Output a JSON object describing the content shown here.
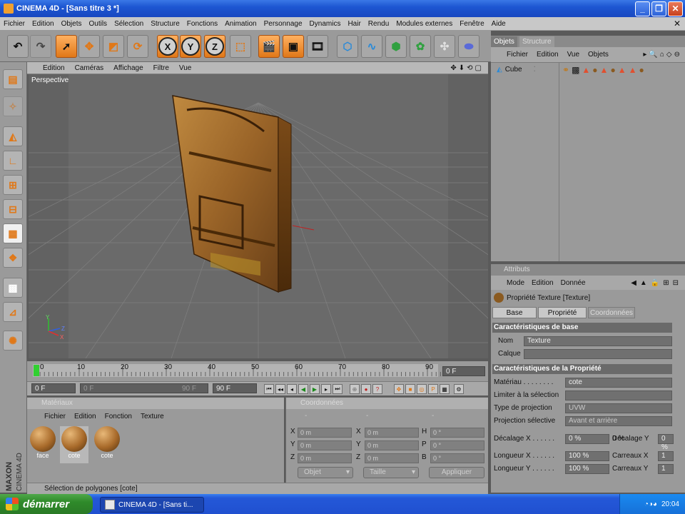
{
  "window": {
    "title": "CINEMA 4D - [Sans titre 3 *]",
    "min_icon": "minimize-icon",
    "max_icon": "maximize-icon",
    "close_icon": "close-icon"
  },
  "menubar": {
    "items": [
      "Fichier",
      "Edition",
      "Objets",
      "Outils",
      "Sélection",
      "Structure",
      "Fonctions",
      "Animation",
      "Personnage",
      "Dynamics",
      "Hair",
      "Rendu",
      "Modules externes",
      "Fenêtre",
      "Aide"
    ]
  },
  "toolbar": {
    "axis_x": "X",
    "axis_y": "Y",
    "axis_z": "Z"
  },
  "viewport": {
    "menu": [
      "Edition",
      "Caméras",
      "Affichage",
      "Filtre",
      "Vue"
    ],
    "label": "Perspective",
    "axis_labels": {
      "y": "Y",
      "z": "Z",
      "x": "X"
    }
  },
  "timeline": {
    "ticks": [
      "0",
      "10",
      "20",
      "30",
      "40",
      "50",
      "60",
      "70",
      "80",
      "90"
    ],
    "current_frame": "0 F",
    "start_frame": "0 F",
    "range_start": "0 F",
    "range_end": "90 F",
    "end_frame": "90 F"
  },
  "materials": {
    "header": "Matériaux",
    "menu": [
      "Fichier",
      "Edition",
      "Fonction",
      "Texture"
    ],
    "items": [
      {
        "name": "face"
      },
      {
        "name": "cote"
      },
      {
        "name": "cote"
      }
    ]
  },
  "coordinates": {
    "header": "Coordonnées",
    "col_headers": [
      "-",
      "-",
      "-"
    ],
    "rows": [
      {
        "a": "X",
        "av": "0 m",
        "b": "X",
        "bv": "0 m",
        "c": "H",
        "cv": "0 °"
      },
      {
        "a": "Y",
        "av": "0 m",
        "b": "Y",
        "bv": "0 m",
        "c": "P",
        "cv": "0 °"
      },
      {
        "a": "Z",
        "av": "0 m",
        "b": "Z",
        "bv": "0 m",
        "c": "B",
        "cv": "0 °"
      }
    ],
    "mode_select": "Objet",
    "size_select": "Taille",
    "apply_button": "Appliquer"
  },
  "statusbar": {
    "text": "Sélection de polygones  [cote]"
  },
  "objects": {
    "tabs": [
      "Objets",
      "Structure"
    ],
    "menu": [
      "Fichier",
      "Edition",
      "Vue",
      "Objets"
    ],
    "list": [
      {
        "name": "Cube"
      }
    ]
  },
  "attributes": {
    "header": "Attributs",
    "menu": [
      "Mode",
      "Edition",
      "Donnée"
    ],
    "title": "Propriété Texture [Texture]",
    "tabs": [
      "Base",
      "Propriété",
      "Coordonnées"
    ],
    "section_base": "Caractéristiques de base",
    "nom_label": "Nom",
    "nom_value": "Texture",
    "calque_label": "Calque",
    "calque_value": "",
    "section_prop": "Caractéristiques de la Propriété",
    "materiau_label": "Matériau . . . . . . . .",
    "materiau_value": "cote",
    "limiter_label": "Limiter à la sélection",
    "limiter_value": "",
    "projection_label": "Type de projection",
    "projection_value": "UVW",
    "proj_selective_label": "Projection sélective",
    "proj_selective_value": "Avant et arrière",
    "decalage_x_label": "Décalage X . . . . . .",
    "decalage_x_value": "0 %",
    "decalage_y_label": "Décalage Y",
    "decalage_y_value": "0 %",
    "longueur_x_label": "Longueur X . . . . . .",
    "longueur_x_value": "100 %",
    "carreaux_x_label": "Carreaux X",
    "carreaux_x_value": "1",
    "longueur_y_label": "Longueur Y . . . . . .",
    "longueur_y_value": "100 %",
    "carreaux_y_label": "Carreaux Y",
    "carreaux_y_value": "1"
  },
  "taskbar": {
    "start": "démarrer",
    "task": "CINEMA 4D - [Sans ti...",
    "clock": "20:04"
  },
  "colors": {
    "accent_orange": "#e07818",
    "titlebar_blue": "#1d56d2",
    "panel_gray": "#9a9a9a",
    "taskbar_green": "#2f8a2a"
  }
}
